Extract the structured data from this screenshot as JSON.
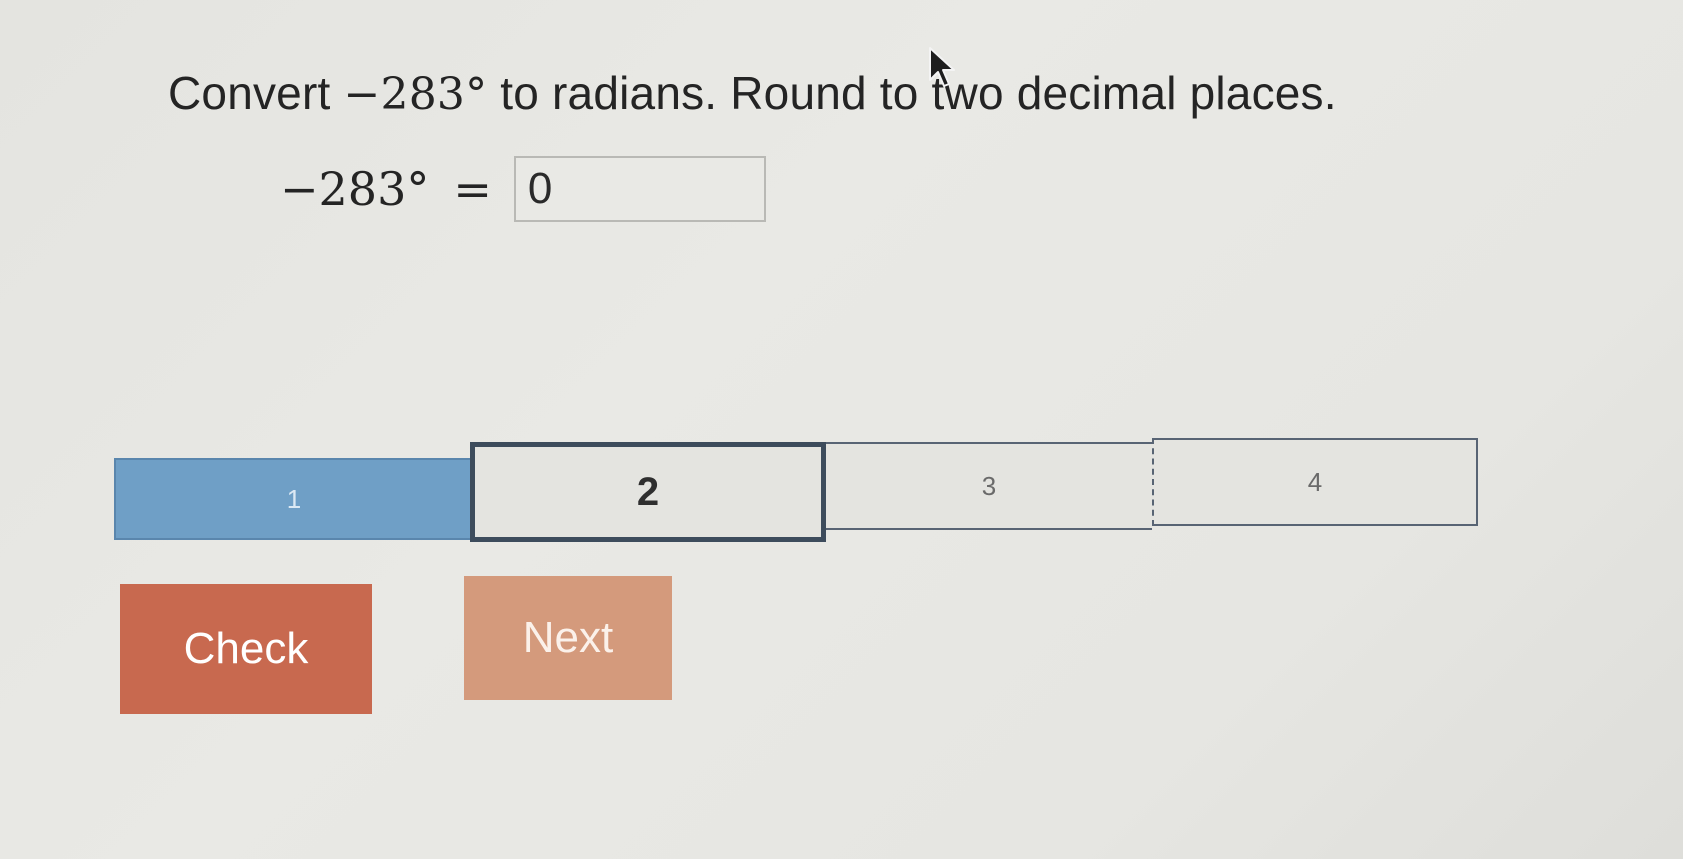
{
  "question": {
    "prefix": "Convert ",
    "value": "−283°",
    "suffix": " to radians. Round to two decimal places."
  },
  "equation": {
    "lhs": "−283°",
    "equals": "=",
    "answer_value": "0"
  },
  "progress": {
    "segments": [
      {
        "label": "1",
        "state": "completed"
      },
      {
        "label": "2",
        "state": "current"
      },
      {
        "label": "3",
        "state": "upcoming"
      },
      {
        "label": "4",
        "state": "upcoming"
      }
    ]
  },
  "buttons": {
    "check_label": "Check",
    "next_label": "Next"
  },
  "colors": {
    "completed_segment": "#6f9fc6",
    "current_segment_border": "#3d4c5c",
    "check_button": "#c8694f",
    "next_button": "#d49a7c"
  },
  "icons": {
    "cursor": "mouse-pointer-icon"
  }
}
